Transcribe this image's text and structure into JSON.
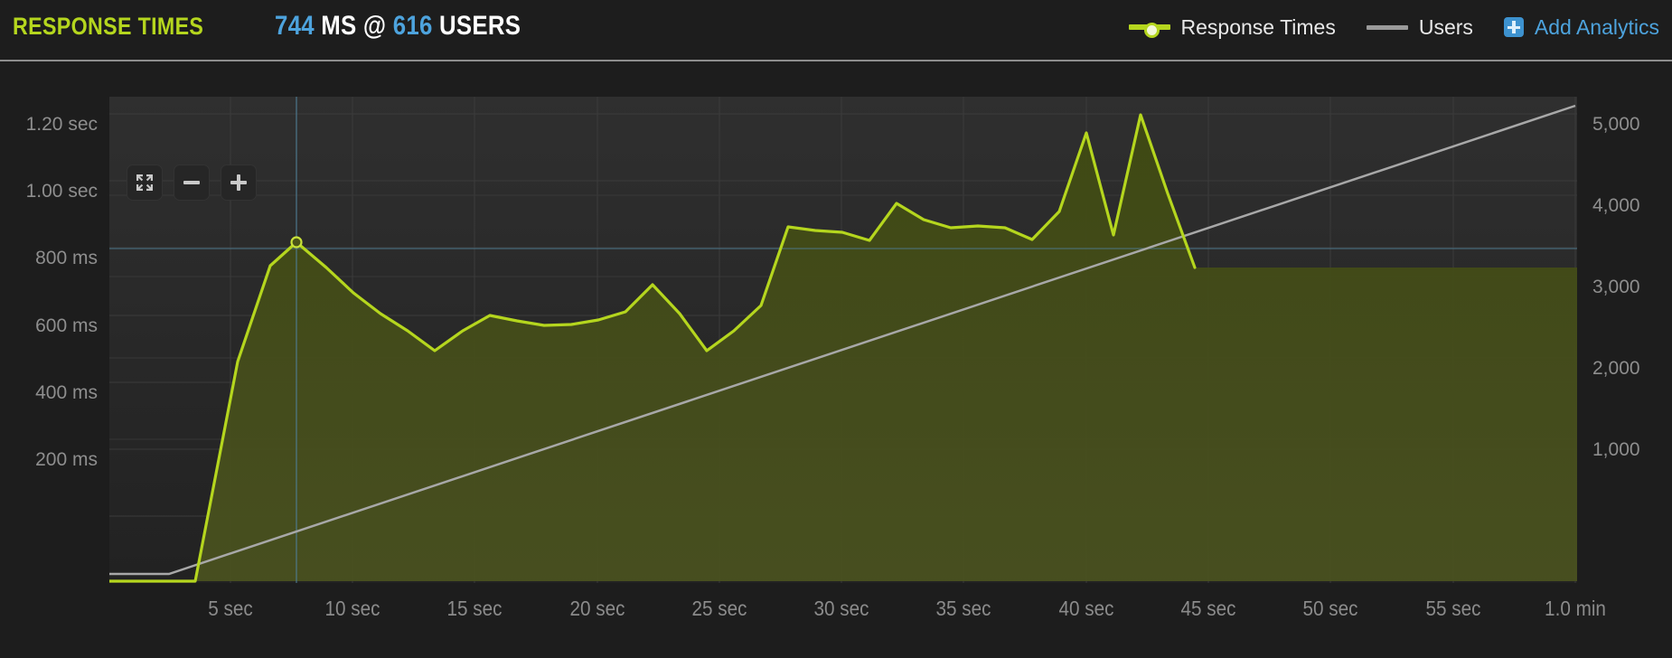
{
  "header": {
    "title": "RESPONSE TIMES",
    "stat_value": "744",
    "stat_unit": "MS",
    "stat_at": "@",
    "stat_users_value": "616",
    "stat_users_unit": "USERS"
  },
  "legend": {
    "items": [
      {
        "label": "Response Times",
        "color": "#b5d61e",
        "marker": "line-with-dot"
      },
      {
        "label": "Users",
        "color": "#9a9a9a",
        "marker": "line"
      }
    ],
    "add_analytics": {
      "label": "Add Analytics",
      "icon": "plus-square-icon",
      "color": "#4da3dd"
    }
  },
  "controls": [
    {
      "name": "fullscreen-button",
      "icon": "expand-arrows-icon"
    },
    {
      "name": "zoom-out-button",
      "icon": "minus-icon"
    },
    {
      "name": "zoom-in-button",
      "icon": "plus-icon"
    }
  ],
  "colors": {
    "response_line": "#b5d61e",
    "response_fill": "#444c18",
    "users_line": "#a8a8a8",
    "accent_blue": "#4da3dd",
    "crosshair": "#4f7d93",
    "plot_bg": "#272727",
    "panel_bg": "#1d1d1d",
    "grid": "#3a3a3a"
  },
  "chart_data": {
    "type": "area",
    "title": "Response Times",
    "xlabel": "",
    "ylabel": "Response time",
    "y2label": "Users",
    "grid": true,
    "legend_position": "top-right",
    "xlim": [
      0,
      62
    ],
    "ylim": [
      0,
      1300
    ],
    "y2lim": [
      0,
      5400
    ],
    "y_ticks": [
      {
        "value": 1200,
        "label": "1.20 sec"
      },
      {
        "value": 1000,
        "label": "1.00 sec"
      },
      {
        "value": 800,
        "label": "800 ms"
      },
      {
        "value": 600,
        "label": "600 ms"
      },
      {
        "value": 400,
        "label": "400 ms"
      },
      {
        "value": 200,
        "label": "200 ms"
      }
    ],
    "y2_ticks": [
      {
        "value": 5000,
        "label": "5,000"
      },
      {
        "value": 4000,
        "label": "4,000"
      },
      {
        "value": 3000,
        "label": "3,000"
      },
      {
        "value": 2000,
        "label": "2,000"
      },
      {
        "value": 1000,
        "label": "1,000"
      }
    ],
    "x_ticks": [
      {
        "value": 5,
        "label": "5 sec"
      },
      {
        "value": 10,
        "label": "10 sec"
      },
      {
        "value": 15,
        "label": "15 sec"
      },
      {
        "value": 20,
        "label": "20 sec"
      },
      {
        "value": 25,
        "label": "25 sec"
      },
      {
        "value": 30,
        "label": "30 sec"
      },
      {
        "value": 35,
        "label": "35 sec"
      },
      {
        "value": 40,
        "label": "40 sec"
      },
      {
        "value": 45,
        "label": "45 sec"
      },
      {
        "value": 50,
        "label": "50 sec"
      },
      {
        "value": 55,
        "label": "55 sec"
      },
      {
        "value": 60,
        "label": "1.0 min"
      }
    ],
    "series": [
      {
        "name": "Response Times",
        "axis": "left",
        "unit": "ms",
        "color": "#b5d61e",
        "fill": "#444c18",
        "x": [
          0,
          2,
          4,
          6,
          8,
          10,
          12,
          14,
          16,
          18,
          20,
          22,
          24,
          26,
          28,
          30,
          32,
          34,
          36,
          38,
          40,
          42,
          44,
          46,
          48,
          50,
          52,
          54,
          56,
          58,
          60
        ],
        "values": [
          5,
          5,
          490,
          700,
          783,
          715,
          660,
          610,
          570,
          515,
          560,
          598,
          590,
          578,
          580,
          592,
          612,
          680,
          608,
          520,
          570,
          635,
          845,
          835,
          830,
          810,
          900,
          860,
          838,
          843,
          838,
          806,
          875,
          1090,
          800,
          1140,
          960,
          744
        ]
      },
      {
        "name": "Users",
        "axis": "right",
        "unit": "users",
        "color": "#a8a8a8",
        "x": [
          0,
          3,
          60
        ],
        "values": [
          60,
          60,
          5020
        ]
      }
    ],
    "annotations": {
      "crosshair_x_value": 8,
      "crosshair_y_value": 744,
      "highlighted_point": {
        "x": 8,
        "y": 783,
        "label": "744 MS @ 616 USERS"
      }
    }
  }
}
